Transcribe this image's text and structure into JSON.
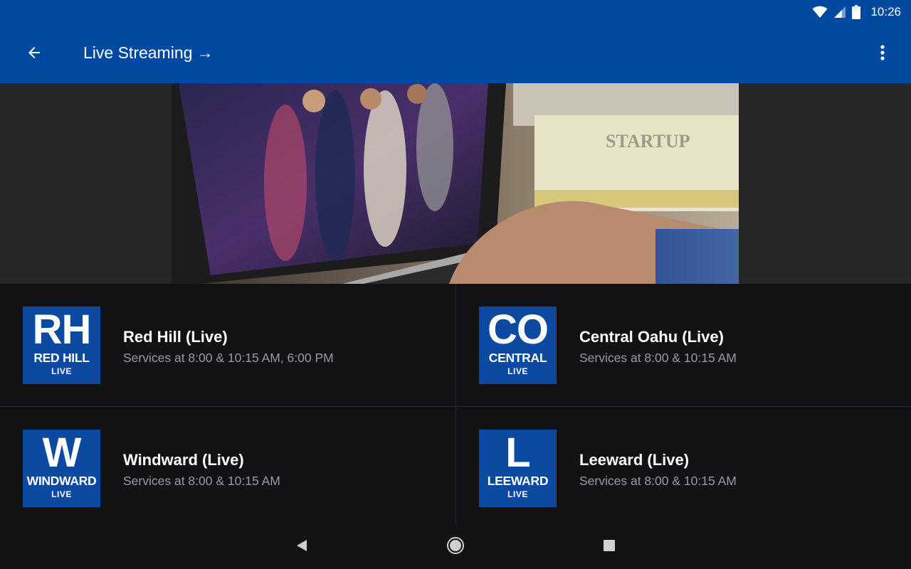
{
  "status_bar": {
    "time": "10:26",
    "icons": [
      "wifi-icon",
      "cell-signal-icon",
      "battery-icon"
    ]
  },
  "app_bar": {
    "title": "Live Streaming →",
    "back_icon": "arrow-back-icon",
    "menu_icon": "more-vert-icon"
  },
  "hero": {
    "description_icon": "laptop-worship-photo"
  },
  "campuses": [
    {
      "logo_letters": "RH",
      "logo_name": "RED HILL",
      "logo_sub": "LIVE",
      "title": "Red Hill (Live)",
      "subtitle": "Services at 8:00 & 10:15 AM, 6:00 PM"
    },
    {
      "logo_letters": "CO",
      "logo_name": "CENTRAL",
      "logo_sub": "LIVE",
      "title": "Central Oahu (Live)",
      "subtitle": "Services at 8:00 & 10:15 AM"
    },
    {
      "logo_letters": "W",
      "logo_name": "WINDWARD",
      "logo_sub": "LIVE",
      "title": "Windward (Live)",
      "subtitle": "Services at 8:00 & 10:15 AM"
    },
    {
      "logo_letters": "L",
      "logo_name": "LEEWARD",
      "logo_sub": "LIVE",
      "title": "Leeward (Live)",
      "subtitle": "Services at 8:00 & 10:15 AM"
    }
  ],
  "nav_bar": {
    "icons": [
      "nav-back-icon",
      "nav-home-icon",
      "nav-recents-icon"
    ]
  },
  "colors": {
    "primary": "#0049a0",
    "logo_blue": "#0b4aa0",
    "background": "#121214",
    "subtitle": "#9a9aa0"
  }
}
